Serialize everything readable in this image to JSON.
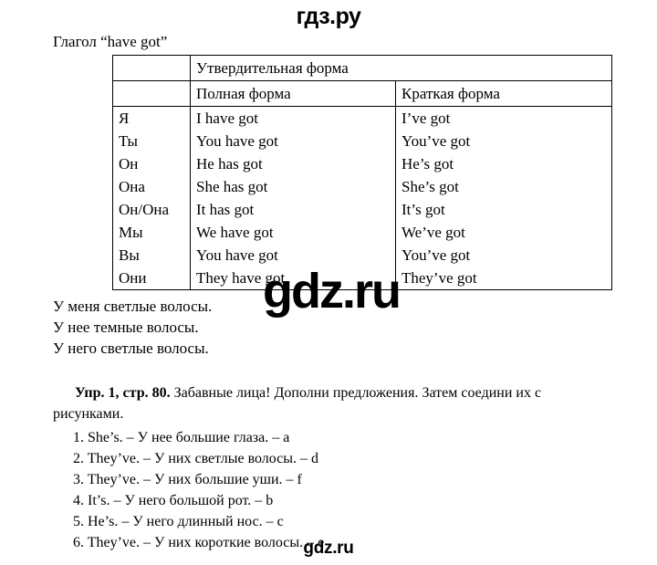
{
  "header": {
    "brand": "гдз.ру"
  },
  "footer": {
    "brand": "gdz.ru"
  },
  "watermark": {
    "text": "gdz.ru"
  },
  "lesson": {
    "title": "Глагол “have got”"
  },
  "table": {
    "header_top": {
      "pronoun_blank": "",
      "affirmative": "Утвердительная форма"
    },
    "header_sub": {
      "pronoun_blank": "",
      "full_form": "Полная форма",
      "short_form": "Краткая форма"
    },
    "rows": [
      {
        "pronoun": "Я",
        "full": "I have got",
        "short": "I’ve got"
      },
      {
        "pronoun": "Ты",
        "full": "You have got",
        "short": "You’ve got"
      },
      {
        "pronoun": "Он",
        "full": "He has got",
        "short": "He’s got"
      },
      {
        "pronoun": "Она",
        "full": "She has got",
        "short": "She’s got"
      },
      {
        "pronoun": "Он/Она",
        "full": "It has got",
        "short": "It’s got"
      },
      {
        "pronoun": "Мы",
        "full": "We have got",
        "short": "We’ve got"
      },
      {
        "pronoun": "Вы",
        "full": "You have got",
        "short": "You’ve got"
      },
      {
        "pronoun": "Они",
        "full": "They have got",
        "short": "They’ve got"
      }
    ]
  },
  "examples": [
    "У меня светлые волосы.",
    "У нее темные волосы.",
    "У него светлые волосы."
  ],
  "exercise": {
    "reference": "Упр. 1, стр. 80.",
    "instruction": " Забавные лица! Дополни предложения. Затем соедини их с рисунками.",
    "answers": [
      "1. She’s. – У нее большие глаза. – a",
      "2. They’ve. – У них светлые волосы. – d",
      "3. They’ve. – У них большие уши. – f",
      "4. It’s. – У него большой рот. – b",
      "5. He’s. – У него длинный нос. – c",
      "6. They’ve. – У них короткие волосы. – e"
    ]
  }
}
